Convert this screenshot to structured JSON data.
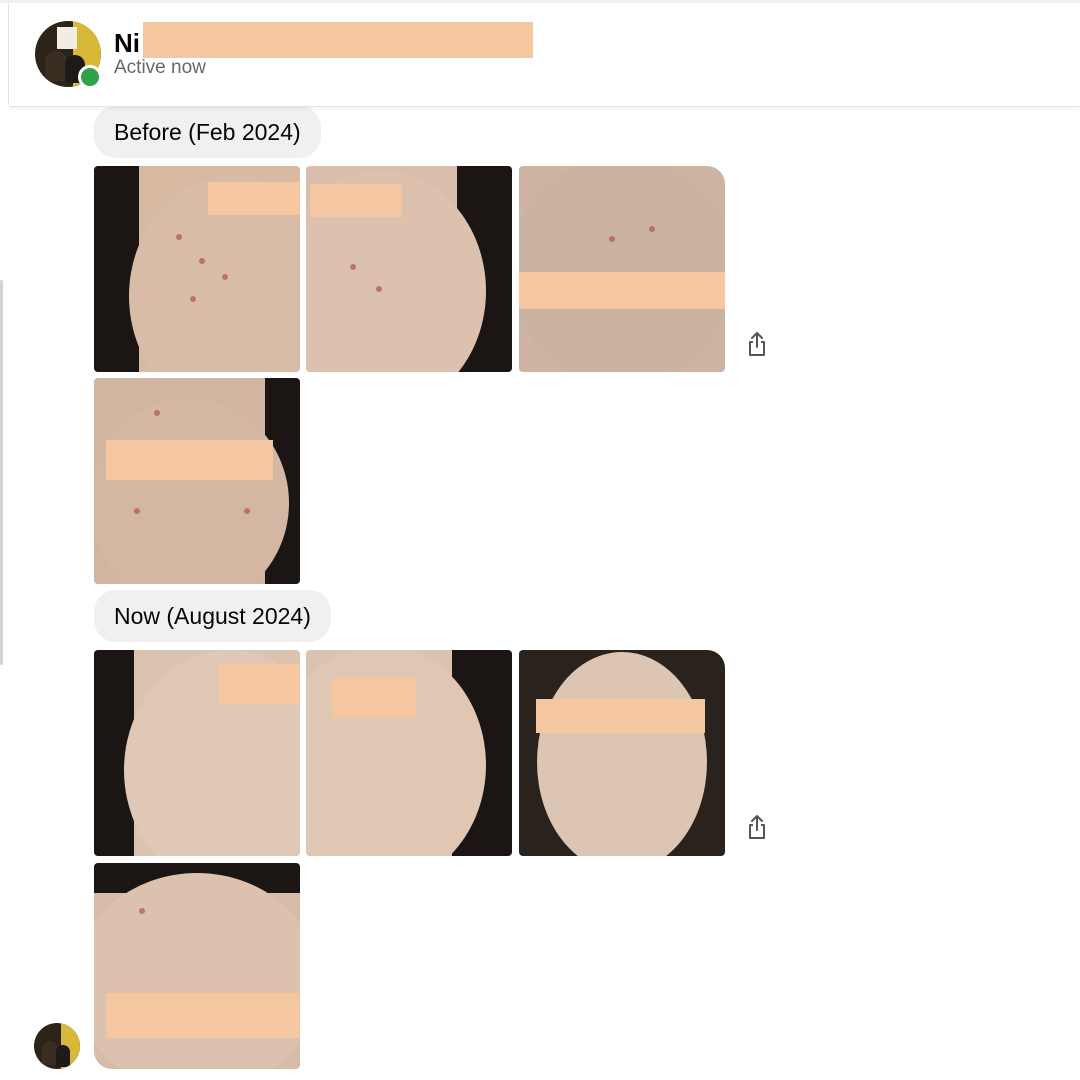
{
  "header": {
    "name_visible": "Ni",
    "status": "Active now"
  },
  "messages": [
    {
      "text": "Before (Feb 2024)"
    },
    {
      "text": "Now (August 2024)"
    }
  ],
  "icons": {
    "share": "share-icon",
    "online": "online-status-dot"
  },
  "colors": {
    "online": "#31a24c",
    "bubble": "#f0f0f0",
    "redaction": "#f5c7a0",
    "secondary_text": "#65676b"
  }
}
